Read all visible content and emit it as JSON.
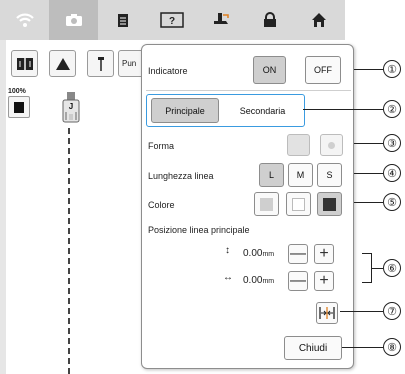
{
  "top_tabs": [
    {
      "icon": "wifi-icon",
      "active": false
    },
    {
      "icon": "camera-icon",
      "active": true
    },
    {
      "icon": "document-icon",
      "active": false
    },
    {
      "icon": "help-icon",
      "active": false,
      "text": "?"
    },
    {
      "icon": "presser-foot-icon",
      "active": false
    },
    {
      "icon": "lock-icon",
      "active": false
    },
    {
      "icon": "home-icon",
      "active": false
    }
  ],
  "toolbar": {
    "pun_label": "Pun"
  },
  "zoom_level": "100%",
  "presser_foot_letter": "J",
  "panel": {
    "indicatore_label": "Indicatore",
    "on_label": "ON",
    "off_label": "OFF",
    "indicatore_value": "ON",
    "principale_label": "Principale",
    "secondaria_label": "Secondaria",
    "selected_line": "Principale",
    "forma_label": "Forma",
    "lunghezza_label": "Lunghezza linea",
    "length_options": [
      "L",
      "M",
      "S"
    ],
    "selected_length": "L",
    "colore_label": "Colore",
    "posizione_label": "Posizione linea principale",
    "vertical_value": "0.00",
    "horizontal_value": "0.00",
    "unit": "mm",
    "minus_label": "—",
    "plus_label": "+",
    "chiudi_label": "Chiudi"
  },
  "callouts": [
    "①",
    "②",
    "③",
    "④",
    "⑤",
    "⑥",
    "⑦",
    "⑧"
  ],
  "colors": {
    "accent_blue": "#3a9be0",
    "tab_bg": "#d9d9d9",
    "selected_bg": "#cfcfcf"
  }
}
